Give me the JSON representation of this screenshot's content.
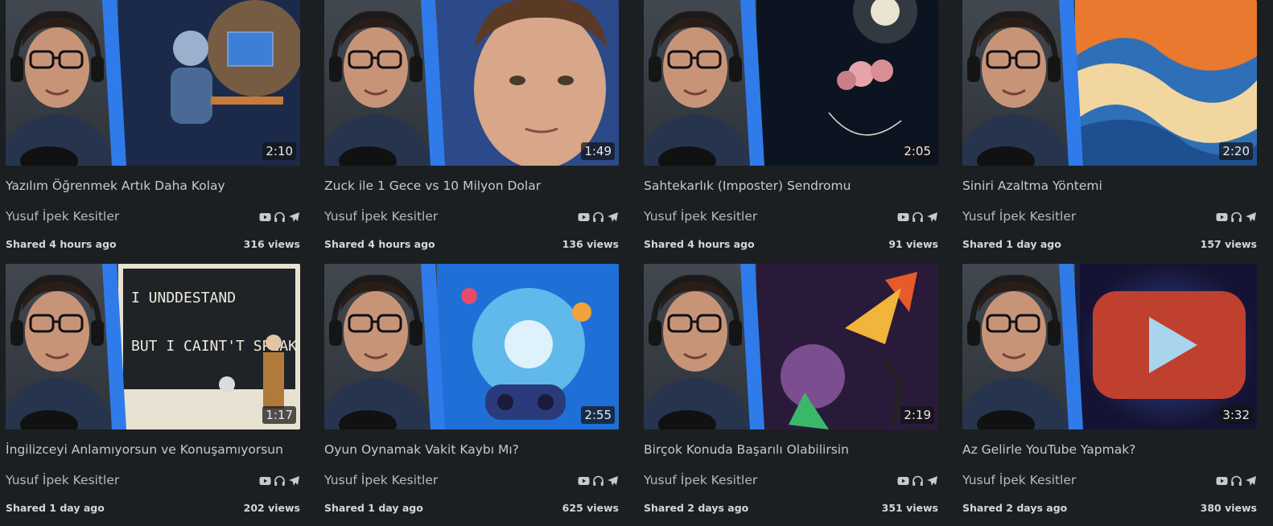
{
  "videos": [
    {
      "title": "Yazılım Öğrenmek Artık Daha Kolay",
      "channel": "Yusuf İpek Kesitler",
      "shared": "Shared 4 hours ago",
      "views": "316 views",
      "duration": "2:10",
      "theme": "robot-coding",
      "colors": [
        "#1b2a4a",
        "#e49a3c"
      ]
    },
    {
      "title": "Zuck ile 1 Gece vs 10 Milyon Dolar",
      "channel": "Yusuf İpek Kesitler",
      "shared": "Shared 4 hours ago",
      "views": "136 views",
      "duration": "1:49",
      "theme": "portrait-face",
      "colors": [
        "#2c4a8a",
        "#d8a688"
      ]
    },
    {
      "title": "Sahtekarlık (Imposter) Sendromu",
      "channel": "Yusuf İpek Kesitler",
      "shared": "Shared 4 hours ago",
      "views": "91 views",
      "duration": "2:05",
      "theme": "flower-moon",
      "colors": [
        "#0c1422",
        "#e9e4d0"
      ]
    },
    {
      "title": "Siniri Azaltma Yöntemi",
      "channel": "Yusuf İpek Kesitler",
      "shared": "Shared 1 day ago",
      "views": "157 views",
      "duration": "2:20",
      "theme": "swirl-waves",
      "colors": [
        "#2f6fb8",
        "#e8792e"
      ]
    },
    {
      "title": "İngilizceyi Anlamıyorsun ve Konuşamıyorsun",
      "channel": "Yusuf İpek Kesitler",
      "shared": "Shared 1 day ago",
      "views": "202 views",
      "duration": "1:17",
      "theme": "chalkboard",
      "colors": [
        "#1e2328",
        "#efe9d9"
      ]
    },
    {
      "title": "Oyun Oynamak Vakit Kaybı Mı?",
      "channel": "Yusuf İpek Kesitler",
      "shared": "Shared 1 day ago",
      "views": "625 views",
      "duration": "2:55",
      "theme": "gamepad-burst",
      "colors": [
        "#1f6fd6",
        "#7cd9f2"
      ]
    },
    {
      "title": "Birçok Konuda Başarılı Olabilirsin",
      "channel": "Yusuf İpek Kesitler",
      "shared": "Shared 2 days ago",
      "views": "351 views",
      "duration": "2:19",
      "theme": "colorful-rocket",
      "colors": [
        "#2a1a3a",
        "#e85a2a"
      ]
    },
    {
      "title": "Az Gelirle YouTube Yapmak?",
      "channel": "Yusuf İpek Kesitler",
      "shared": "Shared 2 days ago",
      "views": "380 views",
      "duration": "3:32",
      "theme": "play-button",
      "colors": [
        "#1a2040",
        "#c04030"
      ]
    }
  ],
  "platform_icons": [
    "youtube-icon",
    "headphones-icon",
    "plane-icon"
  ],
  "accent_stripe": "#2f7bea"
}
